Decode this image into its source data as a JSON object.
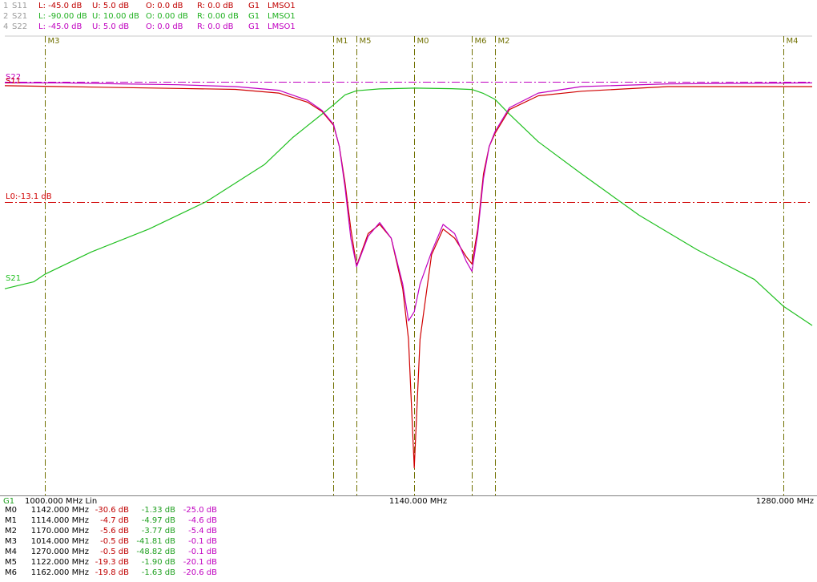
{
  "header": {
    "traces": [
      {
        "index": "1",
        "name": "S11",
        "low": "L: -45.0 dB",
        "up": "U: 5.0 dB",
        "offset": "O: 0.0 dB",
        "ref": "R: 0.0 dB",
        "group": "G1",
        "mode": "LMSO1",
        "color": "#c00000"
      },
      {
        "index": "2",
        "name": "S21",
        "low": "L: -90.00 dB",
        "up": "U: 10.00 dB",
        "offset": "O: 0.00 dB",
        "ref": "R: 0.00 dB",
        "group": "G1",
        "mode": "LMSO1",
        "color": "#20b020"
      },
      {
        "index": "4",
        "name": "S22",
        "low": "L: -45.0 dB",
        "up": "U: 5.0 dB",
        "offset": "O: 0.0 dB",
        "ref": "R: 0.0 dB",
        "group": "G1",
        "mode": "LMSO1",
        "color": "#c000c0"
      }
    ]
  },
  "footer": {
    "group": "G1",
    "start": "1000.000 MHz Lin",
    "center": "1140.000 MHz",
    "stop": "1280.000 MHz"
  },
  "colors": {
    "s11": "#d00000",
    "s21": "#20c020",
    "s22": "#c000c0",
    "marker": "#707000",
    "limit": "#d00000",
    "s22ref": "#c000c0"
  },
  "trace_labels": {
    "s22": "S22",
    "s11": "S11",
    "s21": "S21",
    "limit": "L0:-13.1 dB"
  },
  "markers_table": [
    {
      "name": "M0",
      "freq": "1142.000 MHz",
      "s11": "-30.6 dB",
      "s21": "-1.33 dB",
      "s22": "-25.0 dB"
    },
    {
      "name": "M1",
      "freq": "1114.000 MHz",
      "s11": "-4.7 dB",
      "s21": "-4.97 dB",
      "s22": "-4.6 dB"
    },
    {
      "name": "M2",
      "freq": "1170.000 MHz",
      "s11": "-5.6 dB",
      "s21": "-3.77 dB",
      "s22": "-5.4 dB"
    },
    {
      "name": "M3",
      "freq": "1014.000 MHz",
      "s11": "-0.5 dB",
      "s21": "-41.81 dB",
      "s22": "-0.1 dB"
    },
    {
      "name": "M4",
      "freq": "1270.000 MHz",
      "s11": "-0.5 dB",
      "s21": "-48.82 dB",
      "s22": "-0.1 dB"
    },
    {
      "name": "M5",
      "freq": "1122.000 MHz",
      "s11": "-19.3 dB",
      "s21": "-1.90 dB",
      "s22": "-20.1 dB"
    },
    {
      "name": "M6",
      "freq": "1162.000 MHz",
      "s11": "-19.8 dB",
      "s21": "-1.63 dB",
      "s22": "-20.6 dB"
    }
  ],
  "chart_data": {
    "type": "line",
    "title": "",
    "xlabel": "",
    "ylabel": "",
    "xlim": [
      1000,
      1280
    ],
    "x_unit": "MHz",
    "limit_line": -13.1,
    "series": [
      {
        "name": "S11",
        "scale": [
          -45,
          5
        ],
        "x": [
          1000,
          1020,
          1040,
          1060,
          1080,
          1095,
          1105,
          1110,
          1114,
          1116,
          1118,
          1120,
          1122,
          1126,
          1130,
          1134,
          1138,
          1140,
          1142,
          1144,
          1148,
          1152,
          1156,
          1160,
          1162,
          1164,
          1166,
          1168,
          1170,
          1175,
          1185,
          1200,
          1230,
          1280
        ],
        "values": [
          -0.4,
          -0.5,
          -0.6,
          -0.7,
          -0.8,
          -1.2,
          -2.2,
          -3.2,
          -4.7,
          -7,
          -11,
          -16,
          -20,
          -16.5,
          -15.5,
          -17,
          -22.5,
          -28,
          -42,
          -28,
          -18.8,
          -16,
          -17,
          -19,
          -19.8,
          -16,
          -10,
          -7,
          -5.6,
          -3,
          -1.5,
          -1,
          -0.5,
          -0.5
        ]
      },
      {
        "name": "S21",
        "scale": [
          -90,
          10
        ],
        "x": [
          1000,
          1010,
          1014,
          1030,
          1050,
          1070,
          1090,
          1100,
          1110,
          1114,
          1118,
          1122,
          1130,
          1142,
          1155,
          1162,
          1166,
          1170,
          1175,
          1185,
          1200,
          1220,
          1240,
          1260,
          1270,
          1280
        ],
        "values": [
          -45,
          -43.5,
          -41.81,
          -37,
          -32,
          -26,
          -18,
          -12,
          -7,
          -4.97,
          -2.8,
          -1.9,
          -1.5,
          -1.33,
          -1.45,
          -1.63,
          -2.5,
          -3.77,
          -7,
          -13,
          -20,
          -29,
          -36.5,
          -43,
          -48.82,
          -53
        ]
      },
      {
        "name": "S22",
        "scale": [
          -45,
          5
        ],
        "x": [
          1000,
          1020,
          1040,
          1060,
          1080,
          1095,
          1105,
          1110,
          1114,
          1116,
          1118,
          1120,
          1122,
          1126,
          1130,
          1134,
          1138,
          1140,
          1142,
          1144,
          1148,
          1152,
          1156,
          1160,
          1162,
          1164,
          1166,
          1168,
          1170,
          1175,
          1185,
          1200,
          1230,
          1280
        ],
        "values": [
          -0.1,
          -0.1,
          -0.2,
          -0.3,
          -0.5,
          -0.9,
          -2,
          -3.1,
          -4.6,
          -7,
          -11.5,
          -17,
          -20.1,
          -16.8,
          -15.3,
          -17,
          -22,
          -26,
          -25,
          -22,
          -18.5,
          -15.5,
          -16.5,
          -19.5,
          -20.6,
          -16.5,
          -10.5,
          -7,
          -5.4,
          -2.8,
          -1.2,
          -0.5,
          -0.2,
          -0.1
        ]
      }
    ]
  }
}
